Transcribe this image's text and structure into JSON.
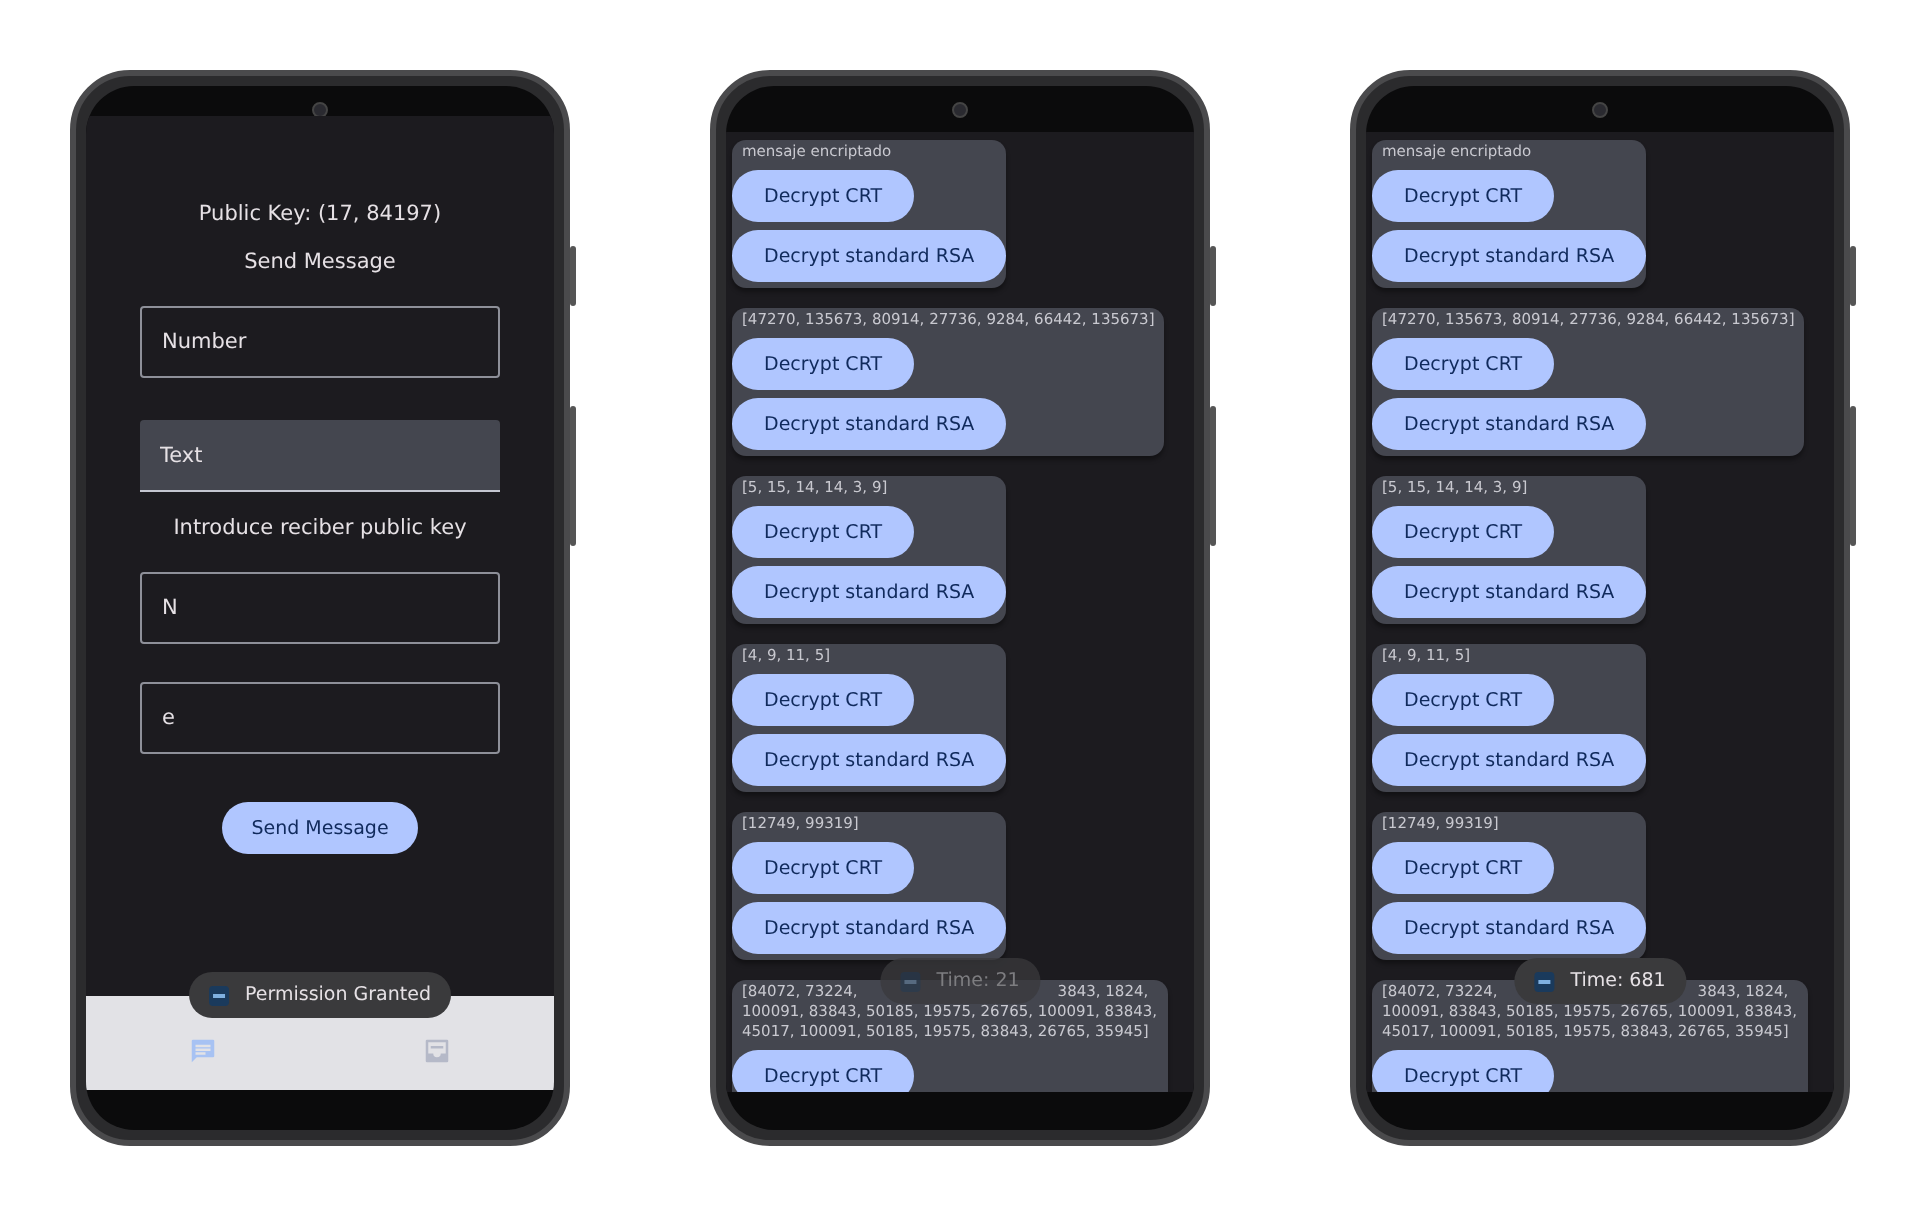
{
  "phones": [
    {
      "kind": "send",
      "public_key": "Public Key: (17, 84197)",
      "heading": "Send Message",
      "fields": [
        {
          "placeholder": "Number",
          "kind": "outlined"
        },
        {
          "placeholder": "Text",
          "kind": "filled"
        }
      ],
      "prompt": "Introduce reciber public key",
      "key_fields": [
        {
          "placeholder": "N",
          "kind": "outlined"
        },
        {
          "placeholder": "e",
          "kind": "outlined"
        }
      ],
      "button": "Send Message",
      "toast": {
        "text": "Permission Granted",
        "faded": false
      },
      "nav": [
        {
          "kind": "chat",
          "selected": true
        },
        {
          "kind": "inbox",
          "selected": false
        }
      ]
    },
    {
      "kind": "messages",
      "messages": [
        {
          "lines": [
            [
              "mensaje encriptado"
            ]
          ],
          "buttons": [
            "Decrypt CRT",
            "Decrypt standard RSA"
          ]
        },
        {
          "lines": [
            [
              "[47270, 135673, 80914, 27736, 9284, 66442, 135673]"
            ]
          ],
          "buttons": [
            "Decrypt CRT",
            "Decrypt standard RSA"
          ]
        },
        {
          "lines": [
            [
              "[5, 15, 14, 14, 3, 9]"
            ]
          ],
          "buttons": [
            "Decrypt CRT",
            "Decrypt standard RSA"
          ]
        },
        {
          "lines": [
            [
              "[4, 9, 11, 5]"
            ]
          ],
          "buttons": [
            "Decrypt CRT",
            "Decrypt standard RSA"
          ]
        },
        {
          "lines": [
            [
              "[12749, 99319]"
            ]
          ],
          "buttons": [
            "Decrypt CRT",
            "Decrypt standard RSA"
          ]
        },
        {
          "lines": [
            [
              "[84072, 73224,",
              "3843, 1824,"
            ],
            [
              "100091, 83843, 50185, 19575, 26765, 100091, 83843,"
            ],
            [
              "45017, 100091, 50185, 19575, 83843, 26765, 35945]"
            ]
          ],
          "buttons": [
            "Decrypt CRT"
          ]
        }
      ],
      "toast": {
        "text": "Time: 21",
        "faded": true
      }
    },
    {
      "kind": "messages",
      "messages": [
        {
          "lines": [
            [
              "mensaje encriptado"
            ]
          ],
          "buttons": [
            "Decrypt CRT",
            "Decrypt standard RSA"
          ]
        },
        {
          "lines": [
            [
              "[47270, 135673, 80914, 27736, 9284, 66442, 135673]"
            ]
          ],
          "buttons": [
            "Decrypt CRT",
            "Decrypt standard RSA"
          ]
        },
        {
          "lines": [
            [
              "[5, 15, 14, 14, 3, 9]"
            ]
          ],
          "buttons": [
            "Decrypt CRT",
            "Decrypt standard RSA"
          ]
        },
        {
          "lines": [
            [
              "[4, 9, 11, 5]"
            ]
          ],
          "buttons": [
            "Decrypt CRT",
            "Decrypt standard RSA"
          ]
        },
        {
          "lines": [
            [
              "[12749, 99319]"
            ]
          ],
          "buttons": [
            "Decrypt CRT",
            "Decrypt standard RSA"
          ]
        },
        {
          "lines": [
            [
              "[84072, 73224,",
              "3843, 1824,"
            ],
            [
              "100091, 83843, 50185, 19575, 26765, 100091, 83843,"
            ],
            [
              "45017, 100091, 50185, 19575, 83843, 26765, 35945]"
            ]
          ],
          "buttons": [
            "Decrypt CRT"
          ]
        }
      ],
      "toast": {
        "text": "Time: 681",
        "faded": false
      }
    }
  ]
}
